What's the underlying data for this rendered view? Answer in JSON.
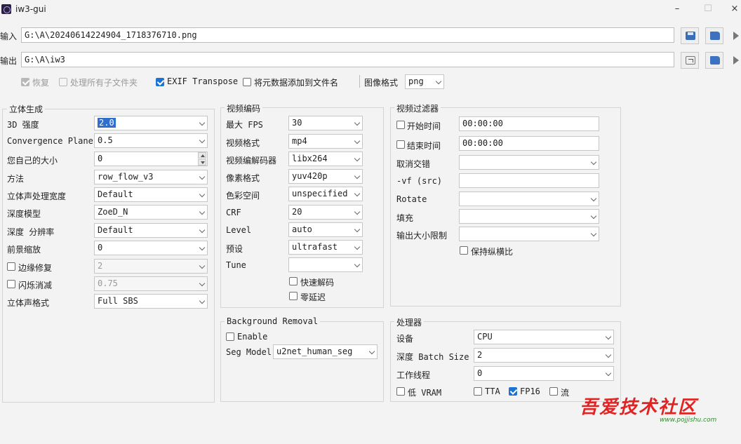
{
  "window": {
    "title": "iw3-gui",
    "minimize": "–",
    "maximize": "☐",
    "close": "×"
  },
  "io": {
    "input_label": "输入",
    "input_path": "G:\\A\\20240614224904_1718376710.png",
    "output_label": "输出",
    "output_path": "G:\\A\\iw3"
  },
  "options": {
    "resume": "恢复",
    "recursive": "处理所有子文件夹",
    "exif": "EXIF Transpose",
    "metadata": "将元数据添加到文件名",
    "image_format_label": "图像格式",
    "image_format": "png"
  },
  "stereo": {
    "title": "立体生成",
    "strength_label": "3D 强度",
    "strength": "2.0",
    "convergence_label": "Convergence Plane",
    "convergence": "0.5",
    "own_size_label": "您自己的大小",
    "own_size": "0",
    "method_label": "方法",
    "method": "row_flow_v3",
    "width_label": "立体声处理宽度",
    "width": "Default",
    "depth_model_label": "深度模型",
    "depth_model": "ZoeD_N",
    "depth_res_label": "深度 分辨率",
    "depth_res": "Default",
    "fg_scale_label": "前景缩放",
    "fg_scale": "0",
    "edge_fix_label": "边缘修复",
    "edge_fix": "2",
    "flicker_label": "闪烁消减",
    "flicker": "0.75",
    "format_label": "立体声格式",
    "format": "Full SBS"
  },
  "video_encoding": {
    "title": "视频编码",
    "fps_label": "最大 FPS",
    "fps": "30",
    "format_label": "视频格式",
    "format": "mp4",
    "codec_label": "视频编解码器",
    "codec": "libx264",
    "pixel_label": "像素格式",
    "pixel": "yuv420p",
    "color_label": "色彩空间",
    "color": "unspecified",
    "crf_label": "CRF",
    "crf": "20",
    "level_label": "Level",
    "level": "auto",
    "preset_label": "预设",
    "preset": "ultrafast",
    "tune_label": "Tune",
    "tune": "",
    "fast_decode": "快速解码",
    "zero_latency": "零延迟"
  },
  "video_filter": {
    "title": "视频过滤器",
    "start_label": "开始时间",
    "start": "00:00:00",
    "end_label": "结束时间",
    "end": "00:00:00",
    "deinterlace_label": "取消交错",
    "deinterlace": "",
    "vf_label": "-vf (src)",
    "vf": "",
    "rotate_label": "Rotate",
    "rotate": "",
    "pad_label": "填充",
    "pad": "",
    "max_size_label": "输出大小限制",
    "max_size": "",
    "keep_aspect": "保持纵横比"
  },
  "bg_removal": {
    "title": "Background Removal",
    "enable": "Enable",
    "seg_model_label": "Seg Model",
    "seg_model": "u2net_human_seg"
  },
  "processor": {
    "title": "处理器",
    "device_label": "设备",
    "device": "CPU",
    "batch_label": "深度 Batch Size",
    "batch": "2",
    "threads_label": "工作线程",
    "threads": "0",
    "low_vram": "低 VRAM",
    "tta": "TTA",
    "fp16": "FP16",
    "stream": "流"
  },
  "watermark": {
    "text": "吾爱技术社区",
    "url": "www.pojjishu.com"
  }
}
